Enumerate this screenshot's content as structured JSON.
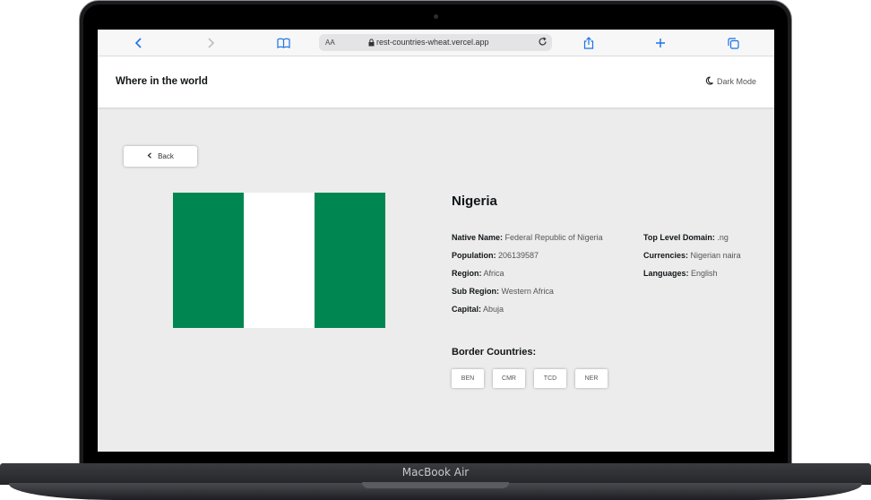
{
  "device": {
    "label": "MacBook Air"
  },
  "browser": {
    "aa_label": "AA",
    "url": "rest-countries-wheat.vercel.app",
    "icons": [
      "chevron-left-icon",
      "chevron-right-icon",
      "book-icon",
      "lock-icon",
      "reload-icon",
      "share-icon",
      "plus-icon",
      "tabs-icon"
    ]
  },
  "header": {
    "title": "Where in the world",
    "dark_mode_label": "Dark Mode"
  },
  "back_label": "Back",
  "country": {
    "name": "Nigeria",
    "flag_colors": [
      "#008751",
      "#ffffff",
      "#008751"
    ],
    "details_left": [
      {
        "key": "Native Name:",
        "value": "Federal Republic of Nigeria"
      },
      {
        "key": "Population:",
        "value": "206139587"
      },
      {
        "key": "Region:",
        "value": "Africa"
      },
      {
        "key": "Sub Region:",
        "value": "Western Africa"
      },
      {
        "key": "Capital:",
        "value": "Abuja"
      }
    ],
    "details_right": [
      {
        "key": "Top Level Domain:",
        "value": ".ng"
      },
      {
        "key": "Currencies:",
        "value": "Nigerian naira"
      },
      {
        "key": "Languages:",
        "value": "English"
      }
    ],
    "border_title": "Border Countries:",
    "borders": [
      "BEN",
      "CMR",
      "TCD",
      "NER"
    ]
  }
}
